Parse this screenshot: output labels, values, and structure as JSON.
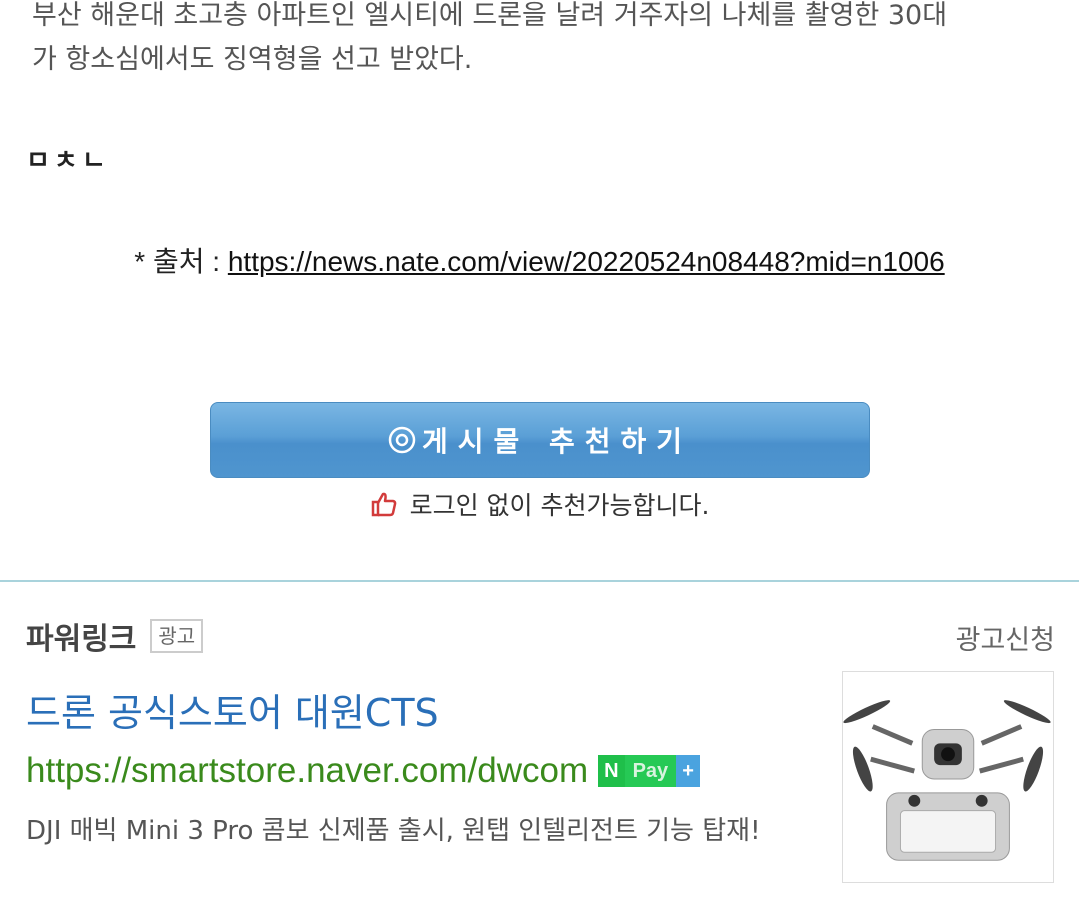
{
  "article": {
    "line1": "부산 해운대 초고층 아파트인 엘시티에 드론을 날려 거주자의 나체를 촬영한 30대",
    "line2": "가 항소심에서도 징역형을 선고 받았다.",
    "reaction": "ㅁㅊㄴ",
    "source_prefix": "* 출처 : ",
    "source_url": "https://news.nate.com/view/20220524n08448?mid=n1006"
  },
  "recommend": {
    "button_label": "게시물 추천하기",
    "note": "로그인 없이 추천가능합니다."
  },
  "powerlink": {
    "title": "파워링크",
    "badge": "광고",
    "apply": "광고신청",
    "ad": {
      "title": "드론 공식스토어 대원CTS",
      "url": "https://smartstore.naver.com/dwcom",
      "npay_n": "N",
      "npay_pay": "Pay",
      "npay_plus": "+",
      "description": "DJI 매빅 Mini 3 Pro 콤보 신제품 출시, 원탭 인텔리전트 기능 탑재!"
    }
  },
  "colors": {
    "button": "#5a9fd6",
    "ad_title": "#2a6fb8",
    "ad_url": "#3a8a1c",
    "divider": "#a9d3dc"
  }
}
